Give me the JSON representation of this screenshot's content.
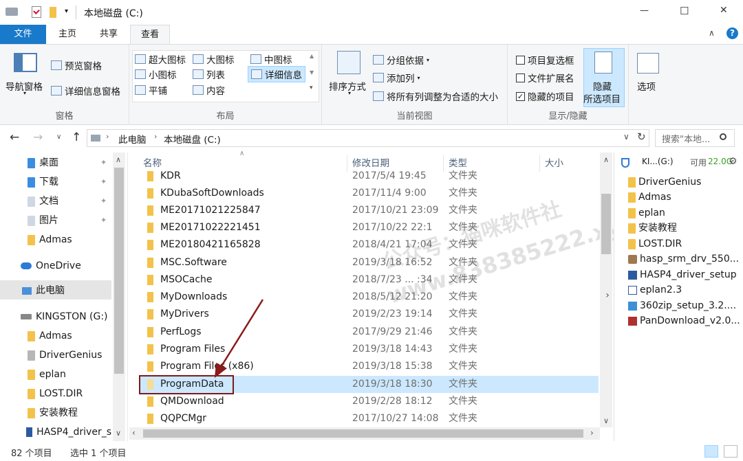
{
  "window": {
    "title": "本地磁盘 (C:)",
    "controls": {
      "minimize": "—",
      "maximize": "☐",
      "close": "✕"
    }
  },
  "tabs": {
    "file": "文件",
    "home": "主页",
    "share": "共享",
    "view": "查看"
  },
  "ribbon": {
    "panes": {
      "nav_pane": "导航窗格",
      "preview_pane": "预览窗格",
      "details_pane": "详细信息窗格",
      "group": "窗格"
    },
    "layout": {
      "xl_icons": "超大图标",
      "large_icons": "大图标",
      "medium_icons": "中图标",
      "small_icons": "小图标",
      "list": "列表",
      "details": "详细信息",
      "tiles": "平铺",
      "content": "内容",
      "group": "布局"
    },
    "current_view": {
      "sort_by": "排序方式",
      "group_by": "分组依据",
      "add_column": "添加列",
      "fit_columns": "将所有列调整为合适的大小",
      "group": "当前视图"
    },
    "show_hide": {
      "item_checkboxes": "项目复选框",
      "file_extensions": "文件扩展名",
      "hidden_items": "隐藏的项目",
      "hide_selected_line1": "隐藏",
      "hide_selected_line2": "所选项目",
      "options": "选项",
      "group": "显示/隐藏",
      "hidden_items_checked": "✓"
    }
  },
  "address": {
    "crumb1": "此电脑",
    "crumb2": "本地磁盘 (C:)",
    "search_placeholder": "搜索\"本地...",
    "refresh": "↻",
    "dropdown": "∨"
  },
  "nav": {
    "items": [
      {
        "label": "桌面"
      },
      {
        "label": "下载"
      },
      {
        "label": "文档"
      },
      {
        "label": "图片"
      },
      {
        "label": "Admas"
      },
      {
        "label": "OneDrive"
      },
      {
        "label": "此电脑"
      },
      {
        "label": "KINGSTON (G:)"
      },
      {
        "label": "Admas"
      },
      {
        "label": "DriverGenius"
      },
      {
        "label": "eplan"
      },
      {
        "label": "LOST.DIR"
      },
      {
        "label": "安装教程"
      },
      {
        "label": "HASP4_driver_s"
      }
    ]
  },
  "columns": {
    "name": "名称",
    "date": "修改日期",
    "type": "类型",
    "size": "大小"
  },
  "files": [
    {
      "name": "KDR",
      "date": "2017/5/4 19:45",
      "type": "文件夹"
    },
    {
      "name": "KDubaSoftDownloads",
      "date": "2017/11/4 9:00",
      "type": "文件夹"
    },
    {
      "name": "ME20171021225847",
      "date": "2017/10/21 23:09",
      "type": "文件夹"
    },
    {
      "name": "ME20171022221451",
      "date": "2017/10/22 22:1",
      "type": "文件夹"
    },
    {
      "name": "ME20180421165828",
      "date": "2018/4/21 17:04",
      "type": "文件夹"
    },
    {
      "name": "MSC.Software",
      "date": "2019/3/18 16:52",
      "type": "文件夹"
    },
    {
      "name": "MSOCache",
      "date": "2018/7/23 ... :34",
      "type": "文件夹"
    },
    {
      "name": "MyDownloads",
      "date": "2018/5/12 21:20",
      "type": "文件夹"
    },
    {
      "name": "MyDrivers",
      "date": "2019/2/23 19:14",
      "type": "文件夹"
    },
    {
      "name": "PerfLogs",
      "date": "2017/9/29 21:46",
      "type": "文件夹"
    },
    {
      "name": "Program Files",
      "date": "2019/3/18 14:43",
      "type": "文件夹"
    },
    {
      "name": "Program Files (x86)",
      "date": "2019/3/18 15:38",
      "type": "文件夹"
    },
    {
      "name": "ProgramData",
      "date": "2019/3/18 18:30",
      "type": "文件夹"
    },
    {
      "name": "QMDownload",
      "date": "2019/2/28 18:12",
      "type": "文件夹"
    },
    {
      "name": "QQPCMgr",
      "date": "2017/10/27 14:08",
      "type": "文件夹"
    }
  ],
  "side": {
    "drive_label": "KI...(G:)",
    "free_label": "可用",
    "free_value": "22.0G",
    "items": [
      {
        "label": "DriverGenius"
      },
      {
        "label": "Admas"
      },
      {
        "label": "eplan"
      },
      {
        "label": "安装教程"
      },
      {
        "label": "LOST.DIR"
      },
      {
        "label": "hasp_srm_drv_550..."
      },
      {
        "label": "HASP4_driver_setup"
      },
      {
        "label": "eplan2.3"
      },
      {
        "label": "360zip_setup_3.2...."
      },
      {
        "label": "PanDownload_v2.0..."
      }
    ]
  },
  "status": {
    "count": "82 个项目",
    "selected": "选中 1 个项目"
  },
  "watermark": {
    "line1": "公众号：猫咪软件社",
    "line2": "www.838385222.xyz"
  },
  "colors": {
    "accent": "#1979ca",
    "selection": "#cce8ff",
    "highlight_box": "#7b1a1a",
    "arrow": "#8b1a1a"
  }
}
